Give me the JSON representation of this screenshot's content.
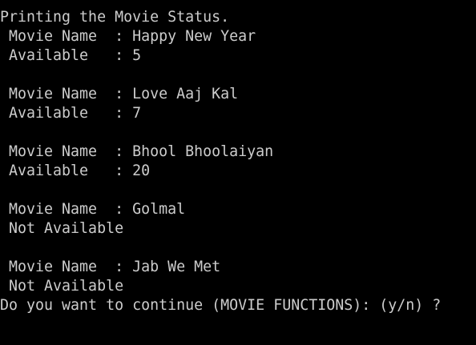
{
  "console": {
    "colors": {
      "background": "#000000",
      "text": "#cccccc"
    },
    "heading": "Printing the Movie Status.",
    "movies": [
      {
        "name_line": " Movie Name  : Happy New Year",
        "status_line": " Available   : 5"
      },
      {
        "name_line": " Movie Name  : Love Aaj Kal",
        "status_line": " Available   : 7"
      },
      {
        "name_line": " Movie Name  : Bhool Bhoolaiyan",
        "status_line": " Available   : 20"
      },
      {
        "name_line": " Movie Name  : Golmal",
        "status_line": " Not Available"
      },
      {
        "name_line": " Movie Name  : Jab We Met",
        "status_line": " Not Available"
      }
    ],
    "prompt": "Do you want to continue (MOVIE FUNCTIONS): (y/n) ?"
  }
}
